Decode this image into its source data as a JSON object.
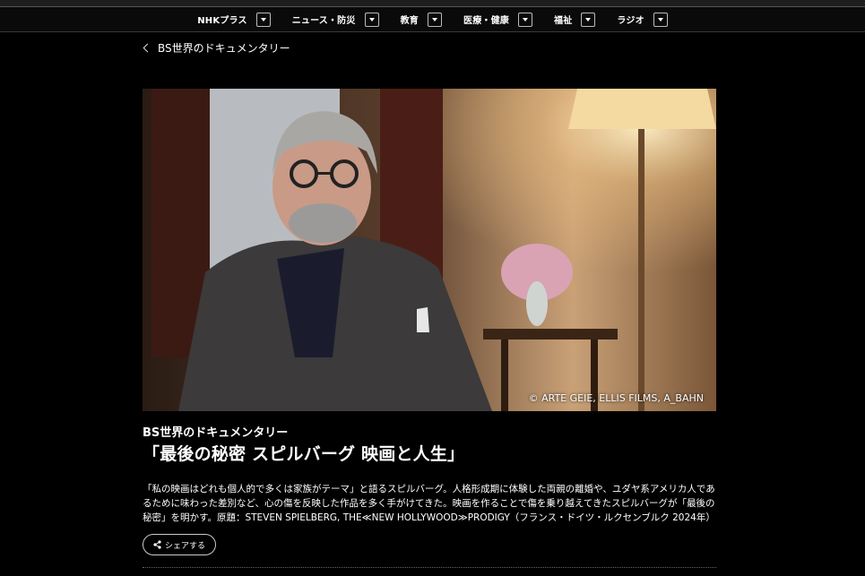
{
  "nav": {
    "items": [
      {
        "label": "NHKプラス"
      },
      {
        "label": "ニュース・防災"
      },
      {
        "label": "教育"
      },
      {
        "label": "医療・健康"
      },
      {
        "label": "福祉"
      },
      {
        "label": "ラジオ"
      }
    ]
  },
  "breadcrumb": {
    "label": "BS世界のドキュメンタリー"
  },
  "hero": {
    "credit": "© ARTE GEIE, ELLIS FILMS, A_BAHN"
  },
  "program": {
    "series": "BS世界のドキュメンタリー",
    "title": "「最後の秘密 スピルバーグ 映画と人生」",
    "description": "「私の映画はどれも個人的で多くは家族がテーマ」と語るスピルバーグ。人格形成期に体験した両親の離婚や、ユダヤ系アメリカ人であるために味わった差別など、心の傷を反映した作品を多く手がけてきた。映画を作ることで傷を乗り越えてきたスピルバーグが「最後の秘密」を明かす。原題：STEVEN SPIELBERG, THE≪NEW HOLLYWOOD≫PRODIGY（フランス・ドイツ・ルクセンブルク 2024年）"
  },
  "share": {
    "label": "シェアする",
    "icon": "share-icon"
  }
}
